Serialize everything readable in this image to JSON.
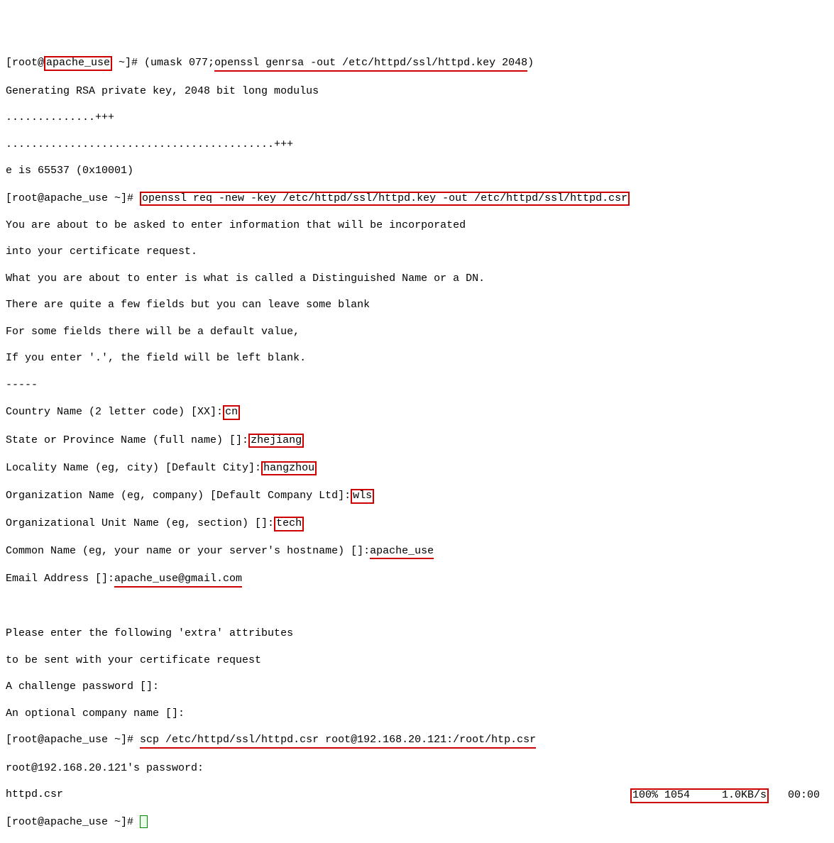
{
  "prompt1_prefix": "[root@",
  "hostname": "apache_use",
  "prompt1_suffix": " ~]# ",
  "cmd1_l": "(umask 077;",
  "cmd1_r": "openssl genrsa -out /etc/httpd/ssl/httpd.key 2048",
  "cmd1_end": ")",
  "genrsa1": "Generating RSA private key, 2048 bit long modulus",
  "genrsa2": "..............+++",
  "genrsa3": "..........................................+++",
  "genrsa4": "e is 65537 (0x10001)",
  "prompt2": "[root@apache_use ~]# ",
  "cmd2": "openssl req -new -key /etc/httpd/ssl/httpd.key -out /etc/httpd/ssl/httpd.csr",
  "req1": "You are about to be asked to enter information that will be incorporated",
  "req2": "into your certificate request.",
  "req3": "What you are about to enter is what is called a Distinguished Name or a DN.",
  "req4": "There are quite a few fields but you can leave some blank",
  "req5": "For some fields there will be a default value,",
  "req6": "If you enter '.', the field will be left blank.",
  "req7": "-----",
  "country_label": "Country Name (2 letter code) [XX]:",
  "country_val": "cn",
  "state_label": "State or Province Name (full name) []:",
  "state_val": "zhejiang",
  "locality_label": "Locality Name (eg, city) [Default City]:",
  "locality_val": "hangzhou",
  "org_label": "Organization Name (eg, company) [Default Company Ltd]:",
  "org_val": "wls",
  "ou_label": "Organizational Unit Name (eg, section) []:",
  "ou_val": "tech",
  "cn_label": "Common Name (eg, your name or your server's hostname) []:",
  "cn_val": "apache_use",
  "email_label": "Email Address []:",
  "email_val": "apache_use@gmail.com",
  "extra1": "Please enter the following 'extra' attributes",
  "extra2": "to be sent with your certificate request",
  "challenge": "A challenge password []:",
  "optcompany": "An optional company name []:",
  "prompt3": "[root@apache_use ~]# ",
  "scp_cmd": "scp /etc/httpd/ssl/httpd.csr root@192.168.20.121:/root/htp.csr",
  "scp_pw": "root@192.168.20.121's password:",
  "scp_file": "httpd.csr",
  "scp_progress": "100% 1054     1.0KB/s",
  "scp_time": "   00:00",
  "prompt4": "[root@apache_use ~]# "
}
